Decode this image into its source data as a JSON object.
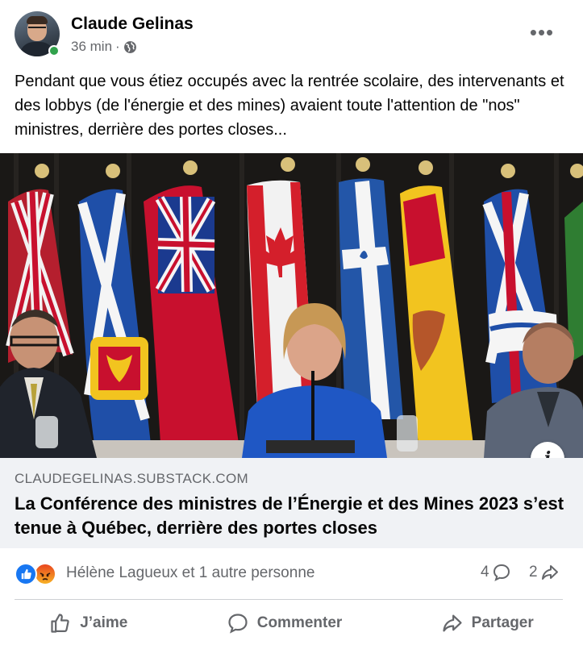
{
  "post": {
    "author": "Claude Gelinas",
    "time": "36 min",
    "separator": "·",
    "privacy_icon": "globe-icon",
    "more_label": "•••",
    "text": "Pendant que vous étiez occupés avec la rentrée scolaire, des intervenants et des lobbys (de l'énergie et des mines) avaient toute l'attention de \"nos\" ministres, derrière des portes closes..."
  },
  "link_preview": {
    "domain": "CLAUDEGELINAS.SUBSTACK.COM",
    "title": "La Conférence des ministres de l’Énergie et des Mines 2023 s’est tenue à Québec, derrière des portes closes",
    "info_label": "i"
  },
  "reactions": {
    "icons": [
      "like-icon",
      "angry-icon"
    ],
    "summary": "Hélène Lagueux et 1 autre personne",
    "comments": "4",
    "shares": "2"
  },
  "actions": {
    "like": "J’aime",
    "comment": "Commenter",
    "share": "Partager"
  },
  "colors": {
    "like_blue": "#1877f2",
    "text_secondary": "#65676b",
    "online_green": "#31a24c",
    "link_bg": "#f0f2f5"
  }
}
